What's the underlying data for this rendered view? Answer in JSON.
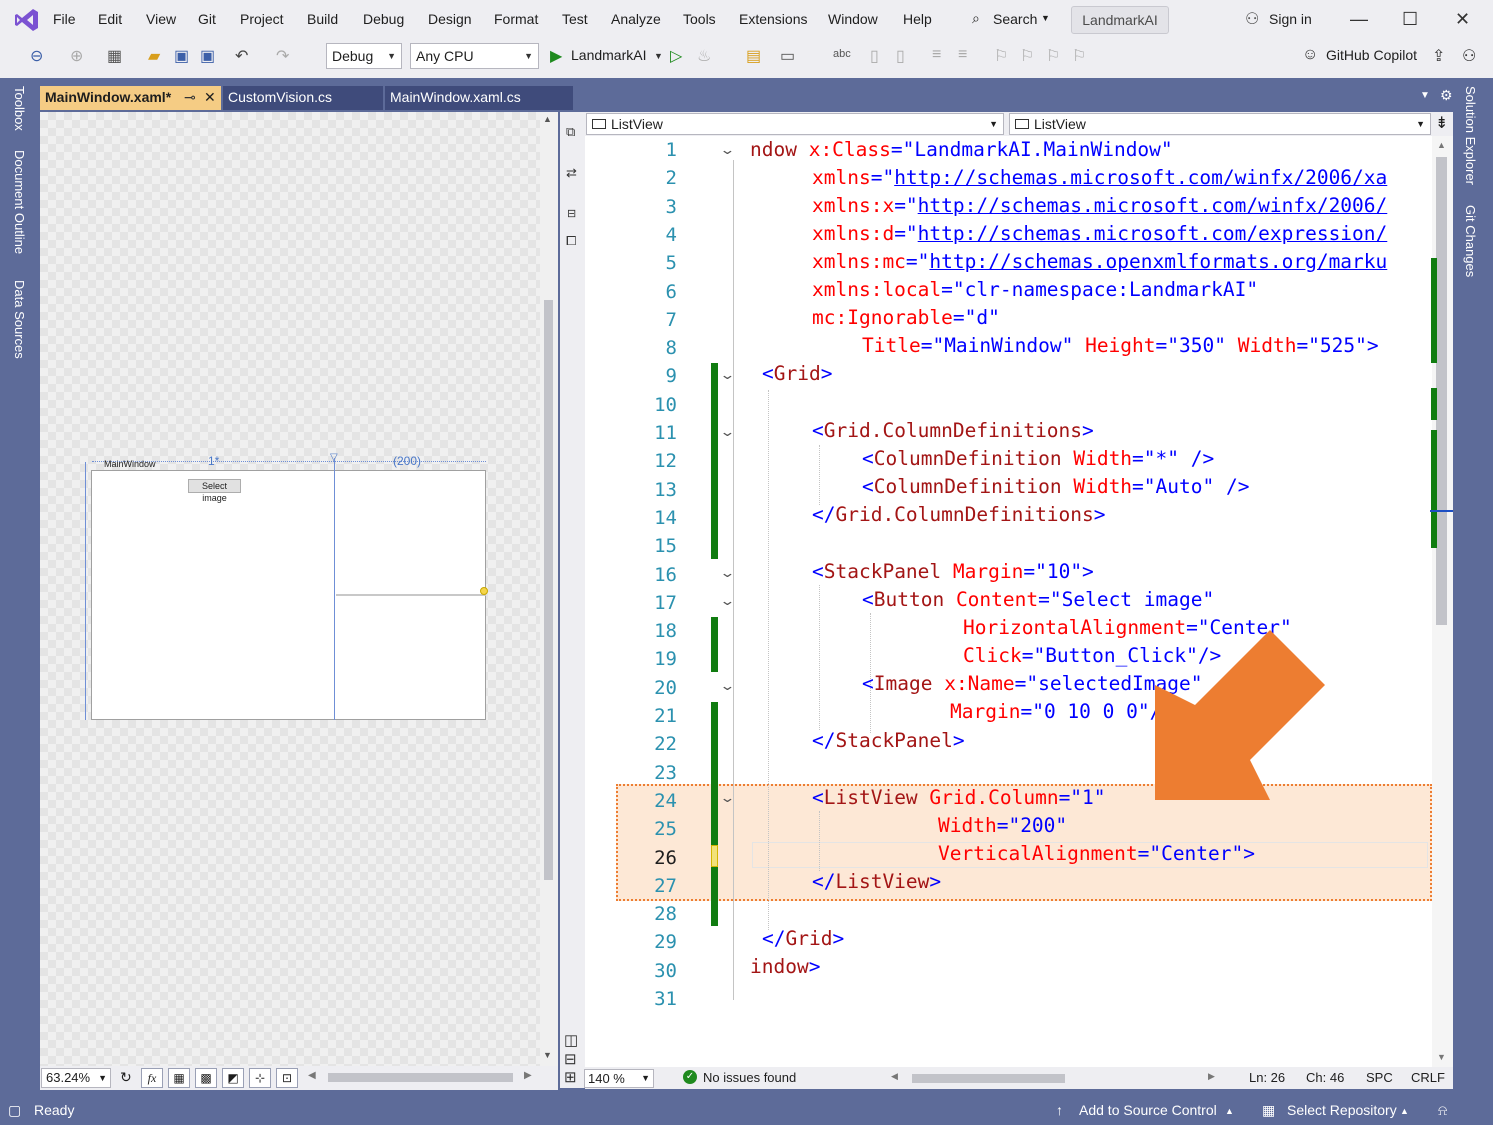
{
  "menubar": {
    "items": [
      "File",
      "Edit",
      "View",
      "Git",
      "Project",
      "Build",
      "Debug",
      "Design",
      "Format",
      "Test",
      "Analyze",
      "Tools",
      "Extensions",
      "Window",
      "Help"
    ],
    "search_label": "Search",
    "solution_title": "LandmarkAI",
    "sign_in": "Sign in"
  },
  "toolbar": {
    "config": "Debug",
    "platform": "Any CPU",
    "run_target": "LandmarkAI",
    "copilot": "GitHub Copilot"
  },
  "side_tabs": [
    "Toolbox",
    "Document Outline",
    "Data Sources"
  ],
  "right_tabs": [
    "Solution Explorer",
    "Git Changes"
  ],
  "doc_tabs": [
    {
      "label": "MainWindow.xaml*",
      "active": true
    },
    {
      "label": "CustomVision.cs",
      "active": false
    },
    {
      "label": "MainWindow.xaml.cs",
      "active": false
    }
  ],
  "designer": {
    "window_title": "MainWindow",
    "col1_label": "1*",
    "col2_label": "(200)",
    "button_label": "Select image",
    "zoom": "63.24%",
    "fx_label": "fx"
  },
  "editor": {
    "nav_left": "ListView",
    "nav_right": "ListView",
    "zoom": "140 %",
    "issues": "No issues found",
    "position": {
      "ln": "Ln: 26",
      "ch": "Ch: 46",
      "spc": "SPC",
      "eol": "CRLF"
    },
    "current_line": 26,
    "line_numbers": [
      "1",
      "2",
      "3",
      "4",
      "5",
      "6",
      "7",
      "8",
      "9",
      "10",
      "11",
      "12",
      "13",
      "14",
      "15",
      "16",
      "17",
      "18",
      "19",
      "20",
      "21",
      "22",
      "23",
      "24",
      "25",
      "26",
      "27",
      "28",
      "29",
      "30",
      "31"
    ],
    "code": {
      "l1": {
        "a": "ndow ",
        "b": "x:Class",
        "c": "=\"",
        "d": "LandmarkAI.MainWindow",
        "e": "\""
      },
      "l2": {
        "a": "xmlns",
        "b": "=\"",
        "c": "http://schemas.microsoft.com/winfx/2006/xa"
      },
      "l3": {
        "a": "xmlns:x",
        "b": "=\"",
        "c": "http://schemas.microsoft.com/winfx/2006/"
      },
      "l4": {
        "a": "xmlns:d",
        "b": "=\"",
        "c": "http://schemas.microsoft.com/expression/"
      },
      "l5": {
        "a": "xmlns:mc",
        "b": "=\"",
        "c": "http://schemas.openxmlformats.org/marku"
      },
      "l6": {
        "a": "xmlns:local",
        "b": "=\"",
        "c": "clr-namespace:LandmarkAI",
        "d": "\""
      },
      "l7": {
        "a": "mc:Ignorable",
        "b": "=\"",
        "c": "d",
        "d": "\""
      },
      "l8": {
        "a": "Title",
        "b": "=\"",
        "c": "MainWindow",
        "d": "\" ",
        "e": "Height",
        "f": "=\"",
        "g": "350",
        "h": "\" ",
        "i": "Width",
        "j": "=\"",
        "k": "525",
        "l": "\">"
      },
      "l9": {
        "a": "<",
        "b": "Grid",
        "c": ">"
      },
      "l11": {
        "a": "<",
        "b": "Grid.ColumnDefinitions",
        "c": ">"
      },
      "l12": {
        "a": "<",
        "b": "ColumnDefinition ",
        "c": "Width",
        "d": "=\"",
        "e": "*",
        "f": "\" />"
      },
      "l13": {
        "a": "<",
        "b": "ColumnDefinition ",
        "c": "Width",
        "d": "=\"",
        "e": "Auto",
        "f": "\" />"
      },
      "l14": {
        "a": "</",
        "b": "Grid.ColumnDefinitions",
        "c": ">"
      },
      "l16": {
        "a": "<",
        "b": "StackPanel ",
        "c": "Margin",
        "d": "=\"",
        "e": "10",
        "f": "\">"
      },
      "l17": {
        "a": "<",
        "b": "Button ",
        "c": "Content",
        "d": "=\"",
        "e": "Select image",
        "f": "\""
      },
      "l18": {
        "a": "HorizontalAlignment",
        "b": "=\"",
        "c": "Center",
        "d": "\""
      },
      "l19": {
        "a": "Click",
        "b": "=\"",
        "c": "Button_Click",
        "d": "\"/>"
      },
      "l20": {
        "a": "<",
        "b": "Image ",
        "c": "x:Name",
        "d": "=\"",
        "e": "selectedImage",
        "f": "\""
      },
      "l21": {
        "a": "Margin",
        "b": "=\"",
        "c": "0 10 0 0",
        "d": "\"/>"
      },
      "l22": {
        "a": "</",
        "b": "StackPanel",
        "c": ">"
      },
      "l24": {
        "a": "<",
        "b": "ListView ",
        "c": "Grid.Column",
        "d": "=\"",
        "e": "1",
        "f": "\""
      },
      "l25": {
        "a": "Width",
        "b": "=\"",
        "c": "200",
        "d": "\""
      },
      "l26": {
        "a": "VerticalAlignment",
        "b": "=\"",
        "c": "Center",
        "d": "\">"
      },
      "l27": {
        "a": "</",
        "b": "ListView",
        "c": ">"
      },
      "l29": {
        "a": "</",
        "b": "Grid",
        "c": ">"
      },
      "l30": {
        "a": "indow",
        "b": ">"
      }
    }
  },
  "statusbar": {
    "ready": "Ready",
    "add_source": "Add to Source Control",
    "select_repo": "Select Repository"
  },
  "colors": {
    "accent": "#5d6b99",
    "active_tab": "#f5cc84",
    "highlight_border": "#ed7d31",
    "arrow": "#ed7d31"
  }
}
